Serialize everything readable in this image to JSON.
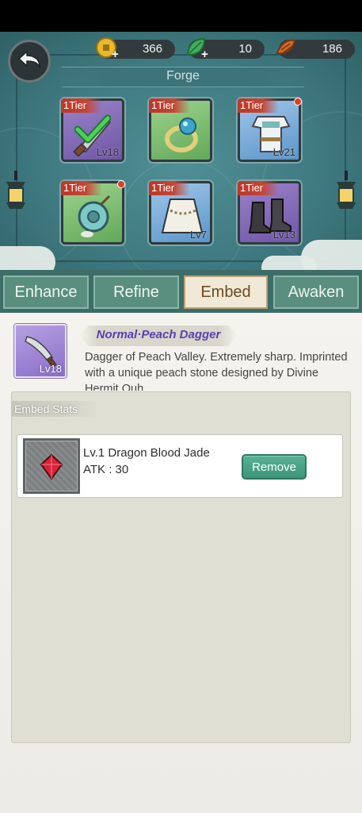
{
  "header": {
    "resources": [
      {
        "name": "coin",
        "value": "366"
      },
      {
        "name": "leaf",
        "value": "10"
      },
      {
        "name": "horn",
        "value": "186"
      }
    ]
  },
  "forge": {
    "title": "Forge",
    "items": [
      {
        "tier": "1Tier",
        "level": "Lv18",
        "rarity": "purple",
        "icon": "dagger-icon",
        "equipped": true,
        "red_dot": false
      },
      {
        "tier": "1Tier",
        "level": "",
        "rarity": "green",
        "icon": "ring-icon",
        "equipped": false,
        "red_dot": false
      },
      {
        "tier": "1Tier",
        "level": "Lv21",
        "rarity": "blue",
        "icon": "armor-icon",
        "equipped": false,
        "red_dot": true
      },
      {
        "tier": "1Tier",
        "level": "",
        "rarity": "green",
        "icon": "necklace-icon",
        "equipped": false,
        "red_dot": true
      },
      {
        "tier": "1Tier",
        "level": "Lv7",
        "rarity": "blue",
        "icon": "cloak-icon",
        "equipped": false,
        "red_dot": false
      },
      {
        "tier": "1Tier",
        "level": "Lv13",
        "rarity": "purple",
        "icon": "boots-icon",
        "equipped": false,
        "red_dot": false
      }
    ]
  },
  "tabs": [
    {
      "label": "Enhance",
      "active": false
    },
    {
      "label": "Refine",
      "active": false
    },
    {
      "label": "Embed",
      "active": true
    },
    {
      "label": "Awaken",
      "active": false
    }
  ],
  "selected_item": {
    "level": "Lv18",
    "name": "Normal·Peach Dagger",
    "description": "Dagger of Peach Valley. Extremely sharp. Imprinted with a unique peach stone designed by Divine Hermit Ouh"
  },
  "embed": {
    "title": "Embed Stats",
    "gem": {
      "name": "Lv.1 Dragon Blood Jade",
      "stat": "ATK : 30",
      "remove_label": "Remove"
    }
  },
  "colors": {
    "accent_green": "#3d957a",
    "tab_active": "#f1e9d6",
    "rarity_purple": "#8a6fc8",
    "rarity_green": "#62a85a",
    "rarity_blue": "#5c95c9"
  }
}
